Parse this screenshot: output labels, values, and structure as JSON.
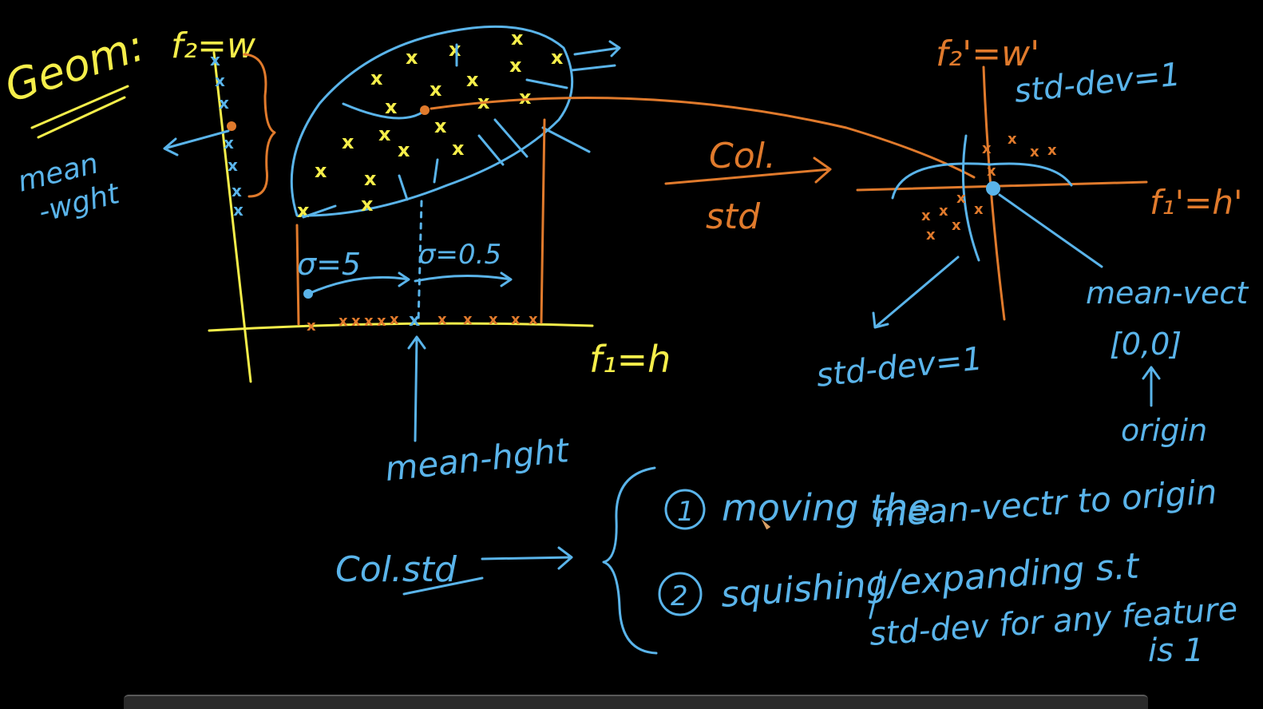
{
  "labels": {
    "geom": "Geom:",
    "f2_axis": "f₂=w",
    "mean_wght": "mean",
    "mean_wght2": "-wght",
    "f1_axis": "f₁=h",
    "sigma_left": "σ=5",
    "sigma_right": "σ=0.5",
    "mean_hght": "mean-hght",
    "col": "Col.",
    "std": "std",
    "f2_prime": "f₂'=w'",
    "std_dev_top": "std-dev=1",
    "f1_prime": "f₁'=h'",
    "mean_vect": "mean-vect",
    "zero_vec": "[0,0]",
    "origin": "origin",
    "std_dev_bottom": "std-dev=1",
    "col_std": "Col.std",
    "step1_num": "1",
    "step1_a": "moving the",
    "step1_b": "mean-vectr to origin",
    "step2_num": "2",
    "step2_a": "squishing/expanding s.t",
    "step2_b": "std-dev for any feature",
    "step2_c": "is 1"
  },
  "colors": {
    "yellow": "#f5ee4a",
    "blue": "#5ab4ea",
    "orange": "#e07a2c",
    "background": "#000000"
  }
}
